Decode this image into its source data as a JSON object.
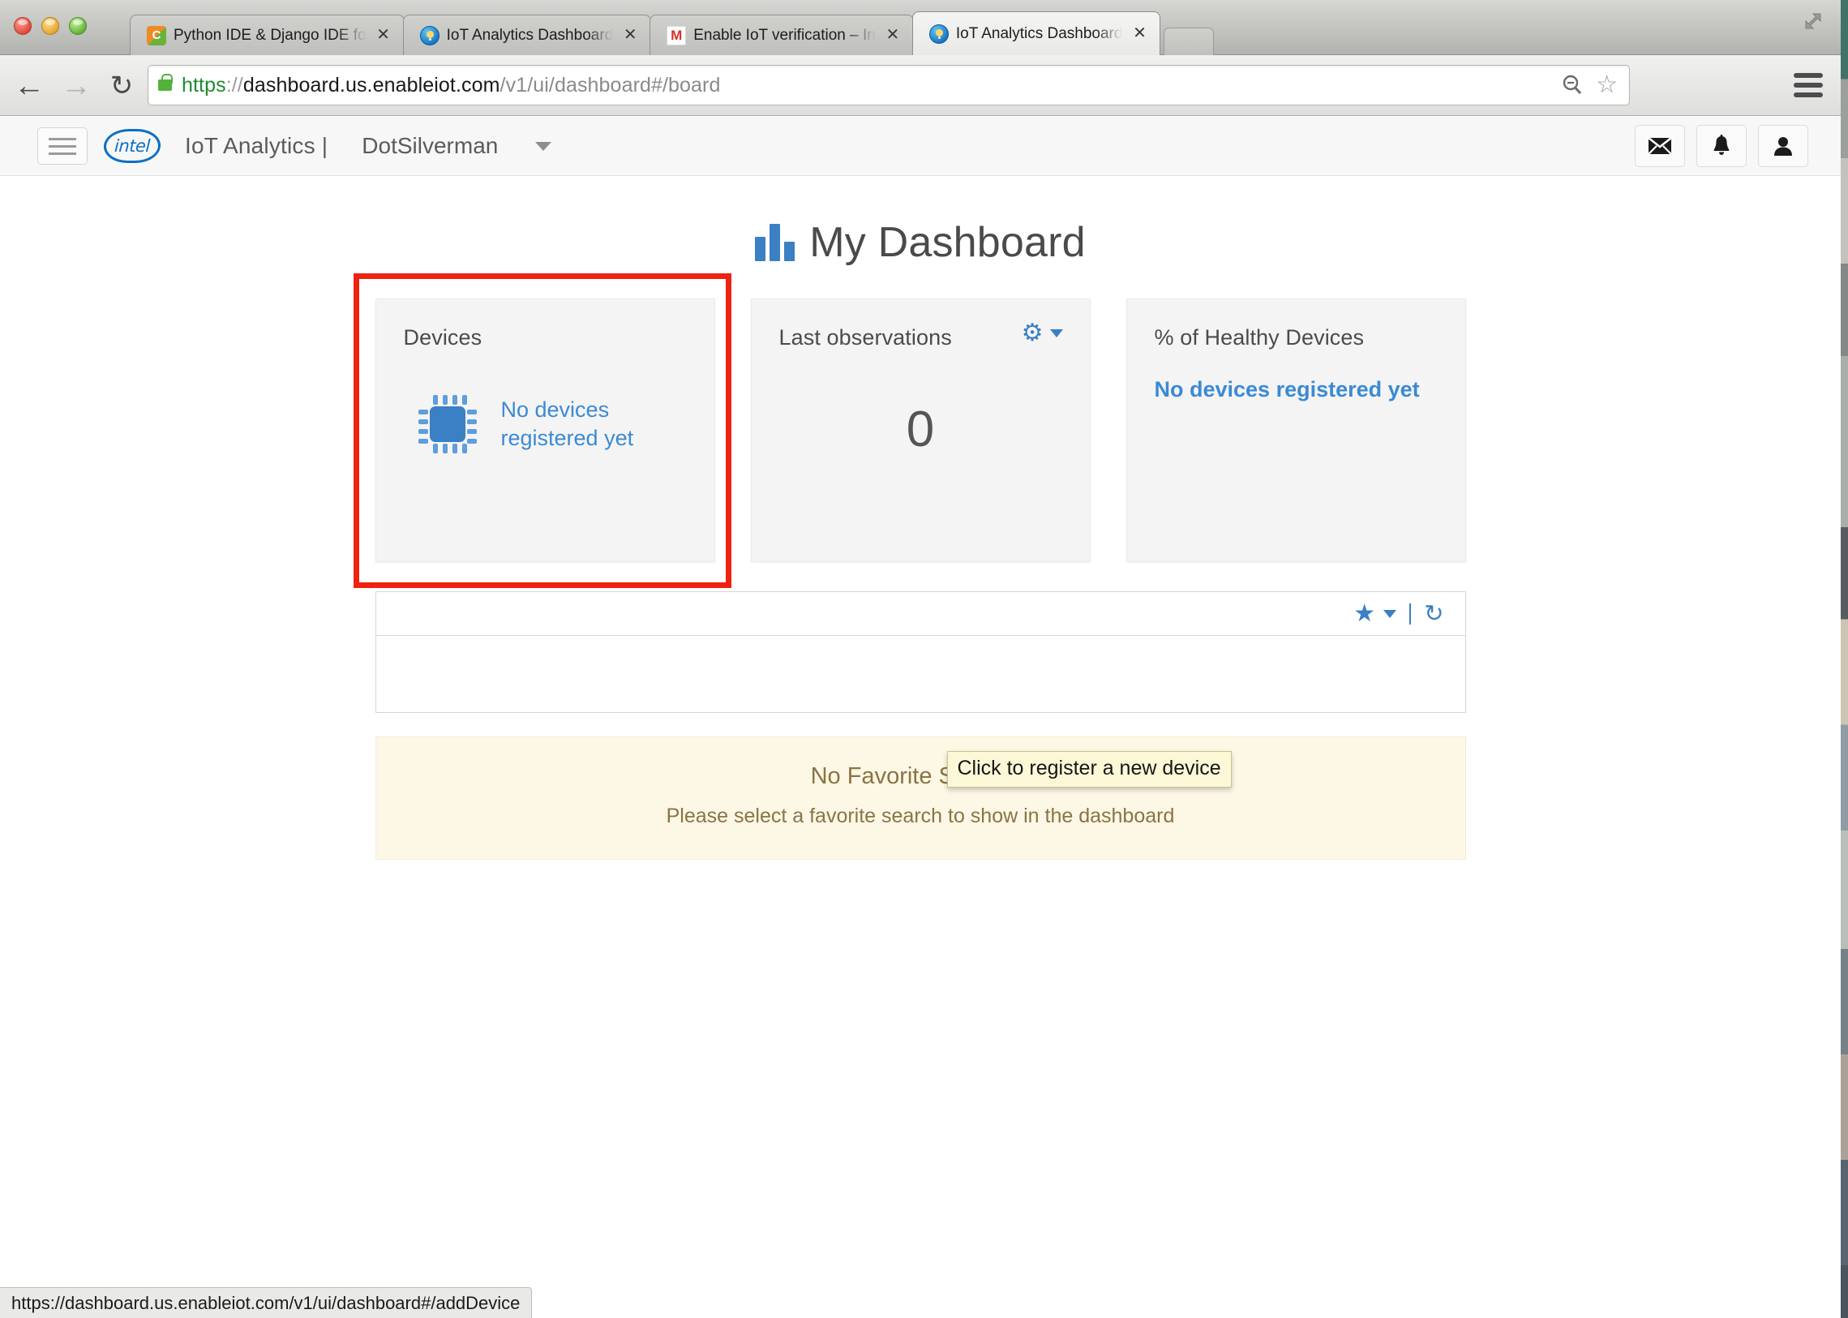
{
  "browser": {
    "window_controls": [
      "close",
      "minimize",
      "maximize"
    ],
    "tabs": [
      {
        "title": "Python IDE & Django IDE fo",
        "favicon": "pycharm-favicon",
        "close_label": "✕",
        "active": false
      },
      {
        "title": "IoT Analytics Dashboard",
        "favicon": "iot-favicon",
        "close_label": "✕",
        "active": false
      },
      {
        "title": "Enable IoT verification – In",
        "favicon": "gmail-favicon",
        "close_label": "✕",
        "active": false
      },
      {
        "title": "IoT Analytics Dashboard",
        "favicon": "iot-favicon",
        "close_label": "✕",
        "active": true
      }
    ],
    "nav": {
      "back_glyph": "←",
      "forward_glyph": "→",
      "reload_glyph": "↻"
    },
    "omnibox": {
      "scheme": "https",
      "separator": "://",
      "host": "dashboard.us.enableiot.com",
      "path": "/v1/ui/dashboard#/board",
      "full_url": "https://dashboard.us.enableiot.com/v1/ui/dashboard#/board",
      "lock_icon": "secure-lock-icon",
      "zoom_out_icon": "zoom-out-icon",
      "bookmark_icon": "star-outline-icon"
    },
    "menu_icon": "hamburger-menu-icon",
    "window_expand_icon": "fullscreen-expand-icon",
    "status_bar_url": "https://dashboard.us.enableiot.com/v1/ui/dashboard#/addDevice"
  },
  "appbar": {
    "menu_toggle_icon": "hamburger-icon",
    "logo_text": "intel",
    "brand": "IoT Analytics |",
    "account": "DotSilverman",
    "caret_icon": "chevron-down-icon",
    "actions": [
      {
        "name": "messages",
        "icon": "envelope-icon",
        "glyph": "✉"
      },
      {
        "name": "notifications",
        "icon": "bell-icon",
        "glyph": "🔔"
      },
      {
        "name": "user",
        "icon": "user-icon",
        "glyph": "👤"
      }
    ]
  },
  "dashboard": {
    "title": "My Dashboard",
    "title_icon": "bar-chart-icon",
    "cards": [
      {
        "title": "Devices",
        "icon": "chip-icon",
        "message": "No devices registered yet",
        "message_line1": "No devices",
        "message_line2": "registered yet",
        "highlighted": true
      },
      {
        "title": "Last observations",
        "value": "0",
        "settings_icon": "gear-icon"
      },
      {
        "title": "% of Healthy Devices",
        "message": "No devices registered yet"
      }
    ],
    "tooltip": "Click to register a new device",
    "search_panel": {
      "favorite_icon": "star-icon",
      "favorite_caret_icon": "chevron-down-icon",
      "refresh_icon": "refresh-icon"
    },
    "alert": {
      "title": "No Favorite Selected",
      "subtitle": "Please select a favorite search to show in the dashboard"
    }
  },
  "colors": {
    "accent_blue": "#3b7fc4",
    "link_blue": "#3b8ad4",
    "highlight_red": "#ee2211",
    "tooltip_bg": "#fcf8d7",
    "alert_bg": "#fdf7e6",
    "alert_text": "#8a7443",
    "card_bg": "#f4f4f4"
  }
}
